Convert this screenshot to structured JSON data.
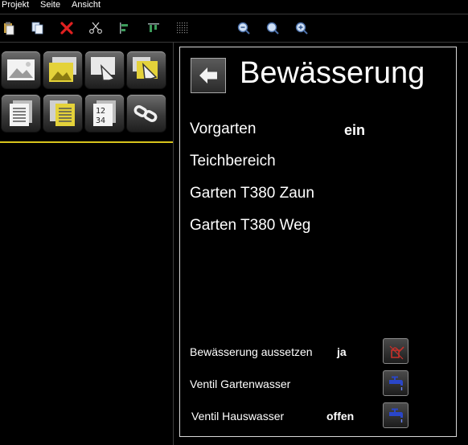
{
  "menu": [
    "Projekt",
    "Seite",
    "Ansicht"
  ],
  "toolbar": {
    "icons": [
      "paste-icon",
      "copy-icon",
      "delete-icon",
      "cut-icon",
      "align-left-icon",
      "align-top-icon",
      "grid-icon",
      "zoom-out-icon",
      "zoom-reset-icon",
      "zoom-in-icon"
    ]
  },
  "palette": {
    "tiles": [
      "image-tile",
      "image-yellow-tile",
      "touch-tile",
      "touch-yellow-tile",
      "page-tile",
      "page-yellow-tile",
      "number-tile",
      "link-tile"
    ],
    "accent": "#d8c41c"
  },
  "page": {
    "title": "Bewässerung",
    "zones": [
      {
        "label": "Vorgarten",
        "status": "ein"
      },
      {
        "label": "Teichbereich",
        "status": ""
      },
      {
        "label": "Garten T380 Zaun",
        "status": ""
      },
      {
        "label": "Garten T380 Weg",
        "status": ""
      }
    ],
    "controls": [
      {
        "label": "Bewässerung aussetzen",
        "status": "ja",
        "icon": "watering-can-icon",
        "icon_color": "#c8302a"
      },
      {
        "label": "Ventil Gartenwasser",
        "status": "",
        "icon": "faucet-icon",
        "icon_color": "#2a46c8"
      },
      {
        "label": "Ventil Hauswasser",
        "status": "offen",
        "icon": "faucet-icon",
        "icon_color": "#2a46c8"
      }
    ]
  }
}
